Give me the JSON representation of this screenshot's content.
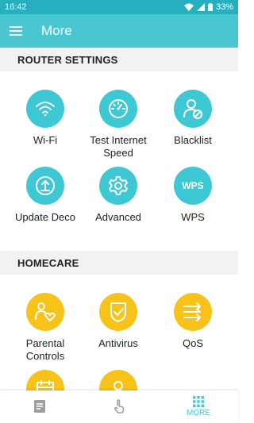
{
  "status_bar": {
    "time": "16:42",
    "battery": "33%"
  },
  "app_bar": {
    "title": "More"
  },
  "router_settings": {
    "header": "ROUTER SETTINGS",
    "items": [
      {
        "label": "Wi-Fi",
        "icon": "wifi-icon"
      },
      {
        "label": "Test Internet Speed",
        "icon": "speedometer-icon"
      },
      {
        "label": "Blacklist",
        "icon": "user-block-icon"
      },
      {
        "label": "Update Deco",
        "icon": "upload-icon"
      },
      {
        "label": "Advanced",
        "icon": "gear-icon"
      },
      {
        "label": "WPS",
        "icon": "wps-icon",
        "icon_text": "WPS"
      }
    ]
  },
  "homecare": {
    "header": "HOMECARE",
    "items": [
      {
        "label": "Parental Controls",
        "icon": "parental-icon"
      },
      {
        "label": "Antivirus",
        "icon": "shield-icon"
      },
      {
        "label": "QoS",
        "icon": "arrows-icon"
      },
      {
        "label": "",
        "icon": "calendar-icon"
      },
      {
        "label": "",
        "icon": "person-icon"
      }
    ]
  },
  "bottom_nav": {
    "items": [
      {
        "label": "",
        "icon": "document-icon"
      },
      {
        "label": "",
        "icon": "tap-icon"
      },
      {
        "label": "MORE",
        "icon": "grid-icon"
      }
    ]
  },
  "colors": {
    "teal": "#3ec8d3",
    "yellow": "#f7c31a",
    "app_bar": "#4ac6d1",
    "status_bar": "#26b0bf"
  }
}
